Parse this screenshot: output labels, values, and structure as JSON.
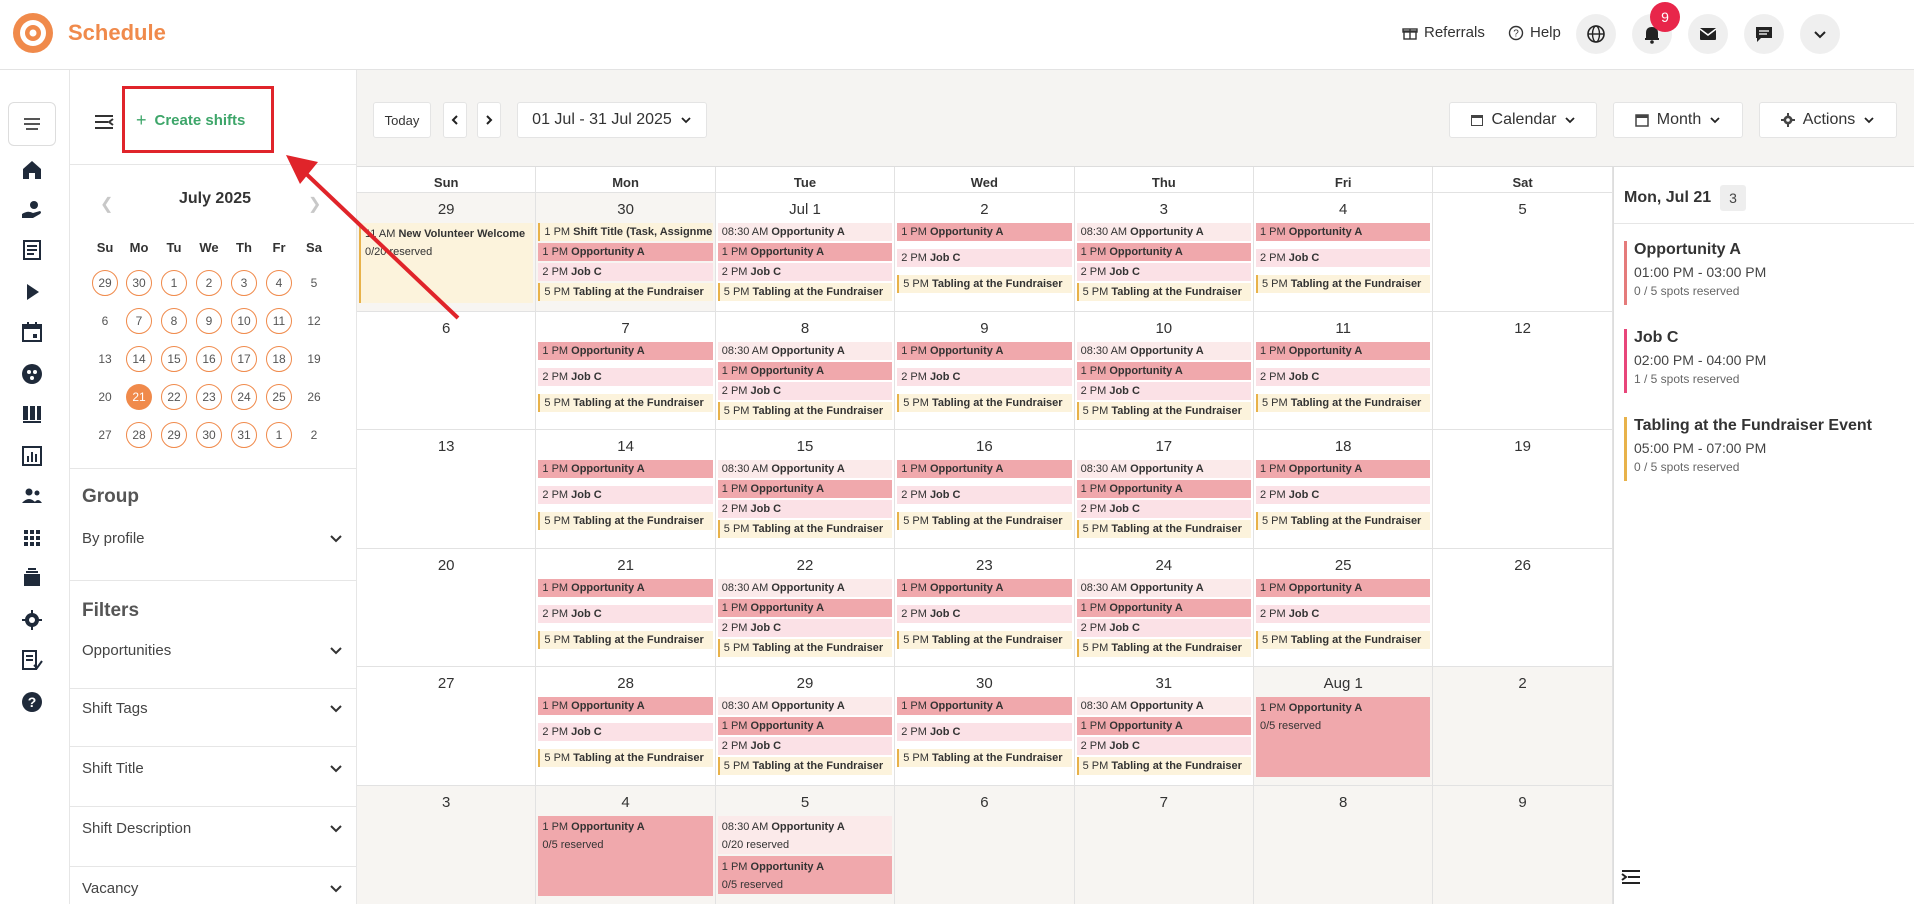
{
  "header": {
    "app_title": "Schedule",
    "referrals_label": "Referrals",
    "help_label": "Help",
    "notification_count": "9",
    "brand_color": "#f08a4b"
  },
  "sidebar": {
    "create_label": "Create shifts",
    "mini_calendar": {
      "title": "July 2025",
      "dow": [
        "Su",
        "Mo",
        "Tu",
        "We",
        "Th",
        "Fr",
        "Sa"
      ],
      "weeks": [
        [
          "29",
          "30",
          "1",
          "2",
          "3",
          "4",
          "5"
        ],
        [
          "6",
          "7",
          "8",
          "9",
          "10",
          "11",
          "12"
        ],
        [
          "13",
          "14",
          "15",
          "16",
          "17",
          "18",
          "19"
        ],
        [
          "20",
          "21",
          "22",
          "23",
          "24",
          "25",
          "26"
        ],
        [
          "27",
          "28",
          "29",
          "30",
          "31",
          "1",
          "2"
        ]
      ],
      "selected": "21"
    },
    "group_heading": "Group",
    "group_by_label": "By profile",
    "filters_heading": "Filters",
    "filters": [
      "Opportunities",
      "Shift Tags",
      "Shift Title",
      "Shift Description",
      "Vacancy"
    ]
  },
  "toolbar": {
    "today_label": "Today",
    "date_range": "01 Jul - 31 Jul 2025",
    "calendar_label": "Calendar",
    "month_label": "Month",
    "actions_label": "Actions"
  },
  "calendar": {
    "dow": [
      "Sun",
      "Mon",
      "Tue",
      "Wed",
      "Thu",
      "Fri",
      "Sat"
    ],
    "weeks": [
      [
        "29",
        "30",
        "Jul 1",
        "2",
        "3",
        "4",
        "5"
      ],
      [
        "6",
        "7",
        "8",
        "9",
        "10",
        "11",
        "12"
      ],
      [
        "13",
        "14",
        "15",
        "16",
        "17",
        "18",
        "19"
      ],
      [
        "20",
        "21",
        "22",
        "23",
        "24",
        "25",
        "26"
      ],
      [
        "27",
        "28",
        "29",
        "30",
        "31",
        "Aug 1",
        "2"
      ],
      [
        "3",
        "4",
        "5",
        "6",
        "7",
        "8",
        "9"
      ]
    ],
    "ev_time_1pm": "1 PM",
    "ev_time_2pm": "2 PM",
    "ev_time_5pm": "5 PM",
    "ev_time_0830": "08:30 AM",
    "ev_time_11am": "11 AM",
    "ev_opp_a": "Opportunity A",
    "ev_job_c": "Job C",
    "ev_tabling": "Tabling at the Fundraiser",
    "ev_shift_title": "Shift Title (Task, Assignment)",
    "ev_new_volunteer": "New Volunteer Welcome",
    "reserved_020": "0/20 reserved",
    "reserved_05": "0/5 reserved"
  },
  "right_panel": {
    "title": "Mon, Jul 21",
    "count": "3",
    "items": [
      {
        "name": "Opportunity A",
        "time": "01:00 PM -  03:00 PM",
        "spots": "0 / 5 spots reserved",
        "color": "#e57b7b"
      },
      {
        "name": "Job C",
        "time": "02:00 PM -  04:00 PM",
        "spots": "1 / 5 spots reserved",
        "color": "#e8467a"
      },
      {
        "name": "Tabling at the Fundraiser Event",
        "time": "05:00 PM -  07:00 PM",
        "spots": "0 / 5 spots reserved",
        "color": "#e8b24a"
      }
    ]
  },
  "annotation": {
    "highlight_color": "#e0242a"
  }
}
